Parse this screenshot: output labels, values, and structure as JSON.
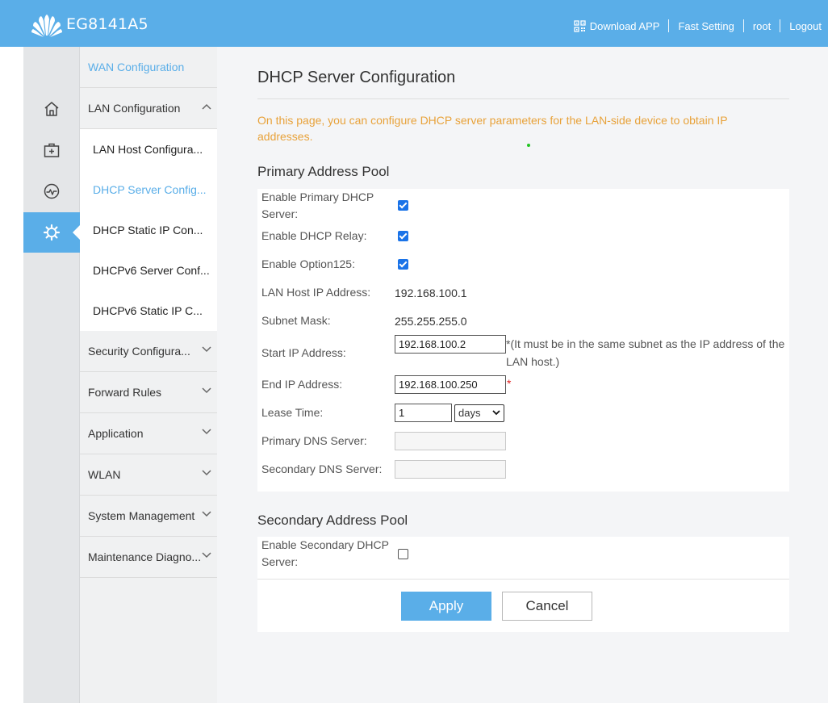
{
  "header": {
    "model": "EG8141A5",
    "nav": [
      "Download APP",
      "Fast Setting",
      "root",
      "Logout"
    ]
  },
  "menu": {
    "items": [
      {
        "label": "WAN Configuration"
      },
      {
        "label": "LAN Configuration"
      },
      {
        "label": "Security Configura..."
      },
      {
        "label": "Forward Rules"
      },
      {
        "label": "Application"
      },
      {
        "label": "WLAN"
      },
      {
        "label": "System Management"
      },
      {
        "label": "Maintenance Diagno..."
      }
    ],
    "sub": [
      {
        "label": "LAN Host Configura..."
      },
      {
        "label": "DHCP Server Config..."
      },
      {
        "label": "DHCP Static IP Con..."
      },
      {
        "label": "DHCPv6 Server Conf..."
      },
      {
        "label": "DHCPv6 Static IP C..."
      }
    ]
  },
  "page": {
    "title": "DHCP Server Configuration",
    "notice": "On this page, you can configure DHCP server parameters for the LAN-side device to obtain IP addresses."
  },
  "primary": {
    "title": "Primary Address Pool",
    "enable_label": "Enable Primary DHCP Server:",
    "relay_label": "Enable DHCP Relay:",
    "opt125_label": "Enable Option125:",
    "lan_ip_label": "LAN Host IP Address:",
    "lan_ip": "192.168.100.1",
    "mask_label": "Subnet Mask:",
    "mask": "255.255.255.0",
    "start_label": "Start IP Address:",
    "start_ip": "192.168.100.2",
    "start_hint": "*(It must be in the same subnet as the IP address of the LAN host.)",
    "end_label": "End IP Address:",
    "end_ip": "192.168.100.250",
    "required_mark": "*",
    "lease_label": "Lease Time:",
    "lease_value": "1",
    "lease_unit": "days",
    "dns1_label": "Primary DNS Server:",
    "dns2_label": "Secondary DNS Server:"
  },
  "secondary": {
    "title": "Secondary Address Pool",
    "enable_label": "Enable Secondary DHCP Server:"
  },
  "buttons": {
    "apply": "Apply",
    "cancel": "Cancel"
  },
  "colors": {
    "brand": "#5aaee8",
    "notice": "#e8a23a",
    "required": "#e02020"
  }
}
